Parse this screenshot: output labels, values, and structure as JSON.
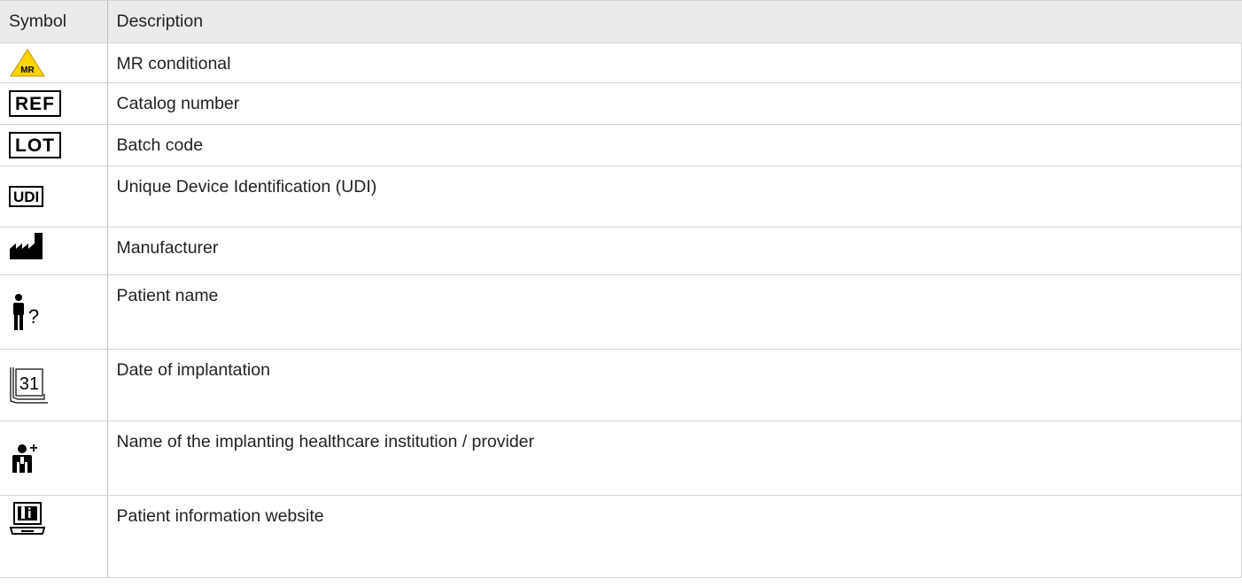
{
  "table": {
    "header": {
      "symbol": "Symbol",
      "description": "Description"
    },
    "rows": [
      {
        "icon": "mr-conditional-icon",
        "symbol_text": "MR",
        "description": "MR conditional"
      },
      {
        "icon": "ref-icon",
        "symbol_text": "REF",
        "description": "Catalog number"
      },
      {
        "icon": "lot-icon",
        "symbol_text": "LOT",
        "description": "Batch code"
      },
      {
        "icon": "udi-icon",
        "symbol_text": "UDI",
        "description": "Unique Device Identification (UDI)"
      },
      {
        "icon": "manufacturer-icon",
        "description": "Manufacturer"
      },
      {
        "icon": "patient-name-icon",
        "symbol_text": "?",
        "description": "Patient name"
      },
      {
        "icon": "calendar-icon",
        "symbol_text": "31",
        "description": "Date of implantation"
      },
      {
        "icon": "healthcare-provider-icon",
        "symbol_text": "+",
        "description": "Name of the implanting healthcare institution / provider"
      },
      {
        "icon": "patient-information-website-icon",
        "description": "Patient information website"
      }
    ]
  }
}
